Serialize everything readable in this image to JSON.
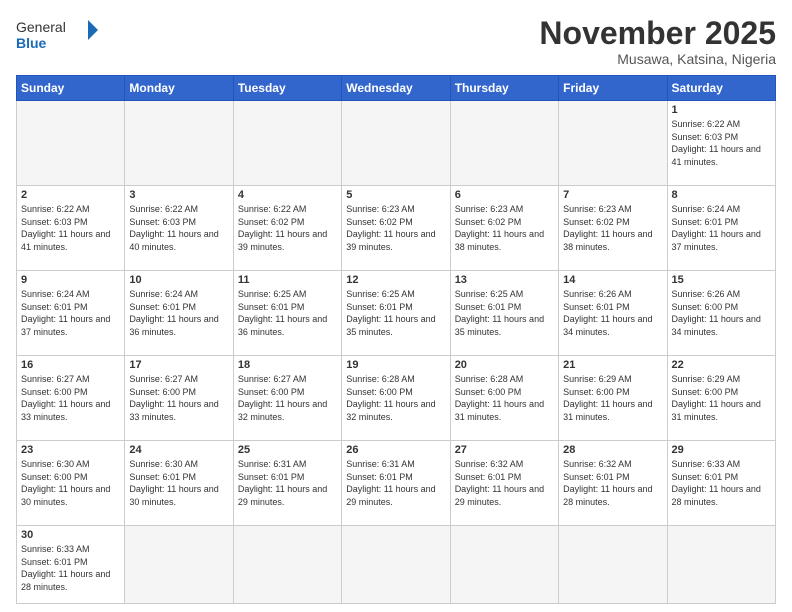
{
  "header": {
    "logo_general": "General",
    "logo_blue": "Blue",
    "month_title": "November 2025",
    "location": "Musawa, Katsina, Nigeria"
  },
  "weekdays": [
    "Sunday",
    "Monday",
    "Tuesday",
    "Wednesday",
    "Thursday",
    "Friday",
    "Saturday"
  ],
  "weeks": [
    [
      {
        "day": "",
        "empty": true
      },
      {
        "day": "",
        "empty": true
      },
      {
        "day": "",
        "empty": true
      },
      {
        "day": "",
        "empty": true
      },
      {
        "day": "",
        "empty": true
      },
      {
        "day": "",
        "empty": true
      },
      {
        "day": "1",
        "sunrise": "6:22 AM",
        "sunset": "6:03 PM",
        "daylight": "11 hours and 41 minutes."
      }
    ],
    [
      {
        "day": "2",
        "sunrise": "6:22 AM",
        "sunset": "6:03 PM",
        "daylight": "11 hours and 41 minutes."
      },
      {
        "day": "3",
        "sunrise": "6:22 AM",
        "sunset": "6:03 PM",
        "daylight": "11 hours and 40 minutes."
      },
      {
        "day": "4",
        "sunrise": "6:22 AM",
        "sunset": "6:02 PM",
        "daylight": "11 hours and 39 minutes."
      },
      {
        "day": "5",
        "sunrise": "6:23 AM",
        "sunset": "6:02 PM",
        "daylight": "11 hours and 39 minutes."
      },
      {
        "day": "6",
        "sunrise": "6:23 AM",
        "sunset": "6:02 PM",
        "daylight": "11 hours and 38 minutes."
      },
      {
        "day": "7",
        "sunrise": "6:23 AM",
        "sunset": "6:02 PM",
        "daylight": "11 hours and 38 minutes."
      },
      {
        "day": "8",
        "sunrise": "6:24 AM",
        "sunset": "6:01 PM",
        "daylight": "11 hours and 37 minutes."
      }
    ],
    [
      {
        "day": "9",
        "sunrise": "6:24 AM",
        "sunset": "6:01 PM",
        "daylight": "11 hours and 37 minutes."
      },
      {
        "day": "10",
        "sunrise": "6:24 AM",
        "sunset": "6:01 PM",
        "daylight": "11 hours and 36 minutes."
      },
      {
        "day": "11",
        "sunrise": "6:25 AM",
        "sunset": "6:01 PM",
        "daylight": "11 hours and 36 minutes."
      },
      {
        "day": "12",
        "sunrise": "6:25 AM",
        "sunset": "6:01 PM",
        "daylight": "11 hours and 35 minutes."
      },
      {
        "day": "13",
        "sunrise": "6:25 AM",
        "sunset": "6:01 PM",
        "daylight": "11 hours and 35 minutes."
      },
      {
        "day": "14",
        "sunrise": "6:26 AM",
        "sunset": "6:01 PM",
        "daylight": "11 hours and 34 minutes."
      },
      {
        "day": "15",
        "sunrise": "6:26 AM",
        "sunset": "6:00 PM",
        "daylight": "11 hours and 34 minutes."
      }
    ],
    [
      {
        "day": "16",
        "sunrise": "6:27 AM",
        "sunset": "6:00 PM",
        "daylight": "11 hours and 33 minutes."
      },
      {
        "day": "17",
        "sunrise": "6:27 AM",
        "sunset": "6:00 PM",
        "daylight": "11 hours and 33 minutes."
      },
      {
        "day": "18",
        "sunrise": "6:27 AM",
        "sunset": "6:00 PM",
        "daylight": "11 hours and 32 minutes."
      },
      {
        "day": "19",
        "sunrise": "6:28 AM",
        "sunset": "6:00 PM",
        "daylight": "11 hours and 32 minutes."
      },
      {
        "day": "20",
        "sunrise": "6:28 AM",
        "sunset": "6:00 PM",
        "daylight": "11 hours and 31 minutes."
      },
      {
        "day": "21",
        "sunrise": "6:29 AM",
        "sunset": "6:00 PM",
        "daylight": "11 hours and 31 minutes."
      },
      {
        "day": "22",
        "sunrise": "6:29 AM",
        "sunset": "6:00 PM",
        "daylight": "11 hours and 31 minutes."
      }
    ],
    [
      {
        "day": "23",
        "sunrise": "6:30 AM",
        "sunset": "6:00 PM",
        "daylight": "11 hours and 30 minutes."
      },
      {
        "day": "24",
        "sunrise": "6:30 AM",
        "sunset": "6:01 PM",
        "daylight": "11 hours and 30 minutes."
      },
      {
        "day": "25",
        "sunrise": "6:31 AM",
        "sunset": "6:01 PM",
        "daylight": "11 hours and 29 minutes."
      },
      {
        "day": "26",
        "sunrise": "6:31 AM",
        "sunset": "6:01 PM",
        "daylight": "11 hours and 29 minutes."
      },
      {
        "day": "27",
        "sunrise": "6:32 AM",
        "sunset": "6:01 PM",
        "daylight": "11 hours and 29 minutes."
      },
      {
        "day": "28",
        "sunrise": "6:32 AM",
        "sunset": "6:01 PM",
        "daylight": "11 hours and 28 minutes."
      },
      {
        "day": "29",
        "sunrise": "6:33 AM",
        "sunset": "6:01 PM",
        "daylight": "11 hours and 28 minutes."
      }
    ],
    [
      {
        "day": "30",
        "sunrise": "6:33 AM",
        "sunset": "6:01 PM",
        "daylight": "11 hours and 28 minutes.",
        "lastRow": true
      },
      {
        "day": "",
        "empty": true,
        "lastRow": true
      },
      {
        "day": "",
        "empty": true,
        "lastRow": true
      },
      {
        "day": "",
        "empty": true,
        "lastRow": true
      },
      {
        "day": "",
        "empty": true,
        "lastRow": true
      },
      {
        "day": "",
        "empty": true,
        "lastRow": true
      },
      {
        "day": "",
        "empty": true,
        "lastRow": true
      }
    ]
  ],
  "labels": {
    "sunrise": "Sunrise:",
    "sunset": "Sunset:",
    "daylight": "Daylight:"
  }
}
